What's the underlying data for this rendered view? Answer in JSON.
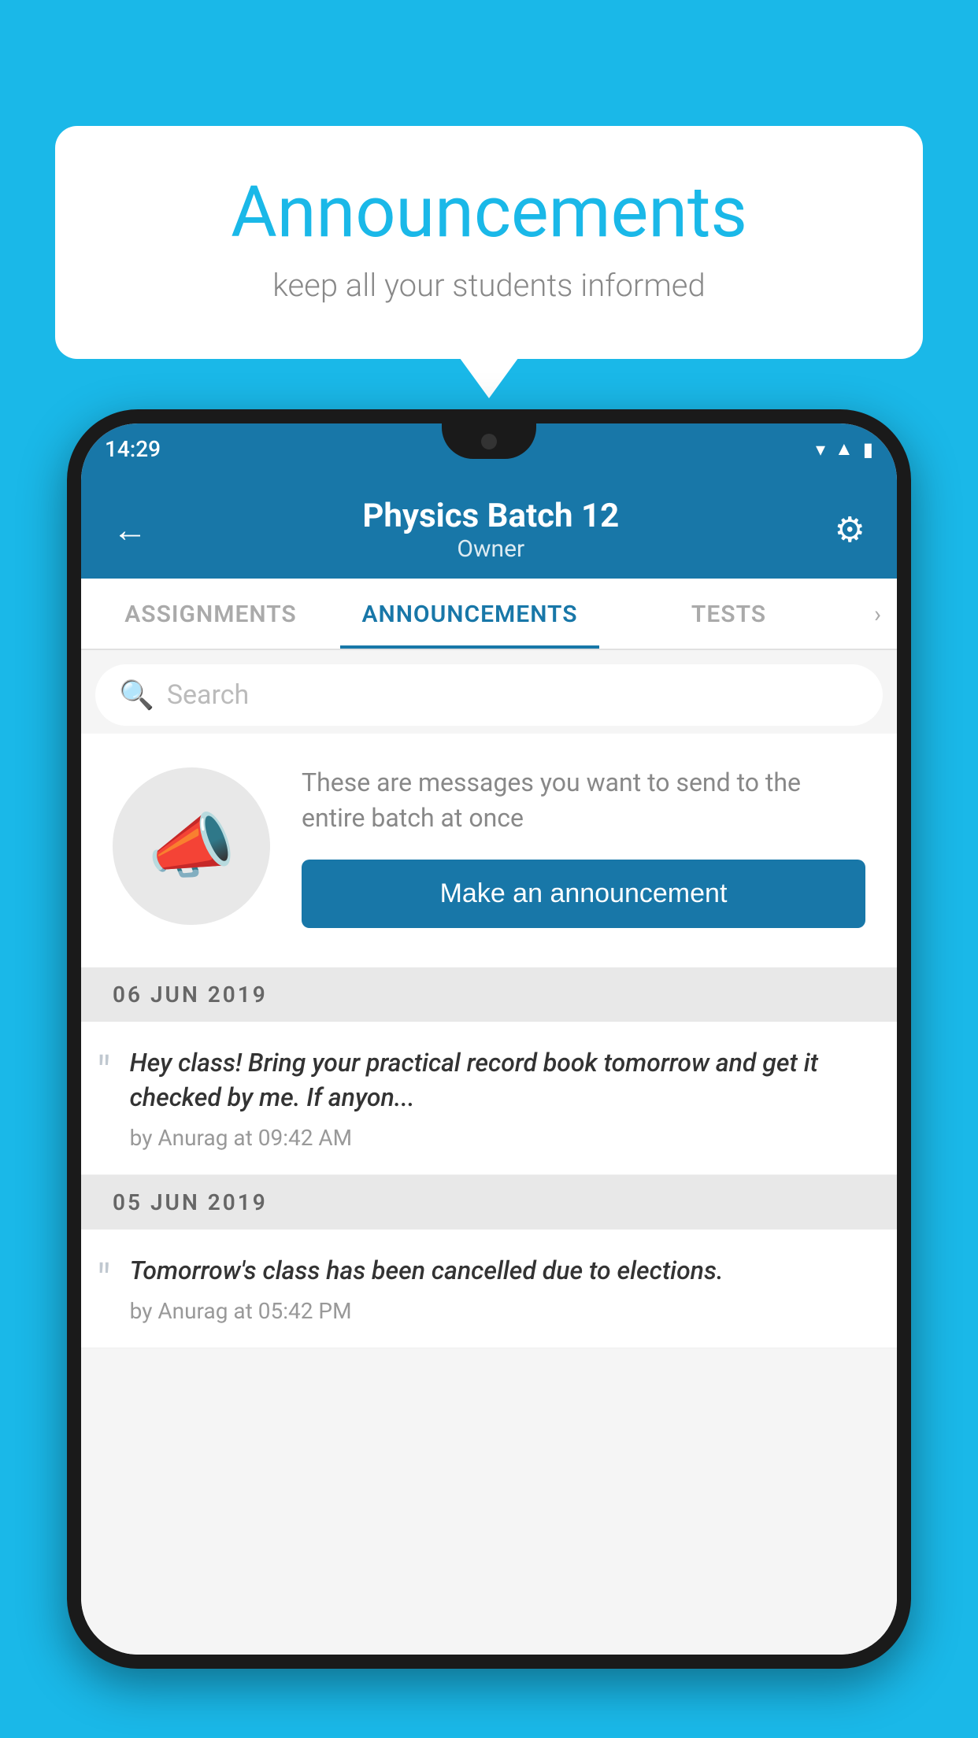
{
  "background_color": "#1ab8e8",
  "speech_bubble": {
    "title": "Announcements",
    "subtitle": "keep all your students informed"
  },
  "phone": {
    "status_bar": {
      "time": "14:29"
    },
    "header": {
      "title": "Physics Batch 12",
      "subtitle": "Owner",
      "back_label": "←",
      "gear_label": "⚙"
    },
    "tabs": [
      {
        "label": "ASSIGNMENTS",
        "active": false
      },
      {
        "label": "ANNOUNCEMENTS",
        "active": true
      },
      {
        "label": "TESTS",
        "active": false
      }
    ],
    "search": {
      "placeholder": "Search"
    },
    "announcement_prompt": {
      "description": "These are messages you want to send to the entire batch at once",
      "button_label": "Make an announcement"
    },
    "announcements": [
      {
        "date": "06  JUN  2019",
        "text": "Hey class! Bring your practical record book tomorrow and get it checked by me. If anyon...",
        "meta": "by Anurag at 09:42 AM"
      },
      {
        "date": "05  JUN  2019",
        "text": "Tomorrow's class has been cancelled due to elections.",
        "meta": "by Anurag at 05:42 PM"
      }
    ]
  }
}
